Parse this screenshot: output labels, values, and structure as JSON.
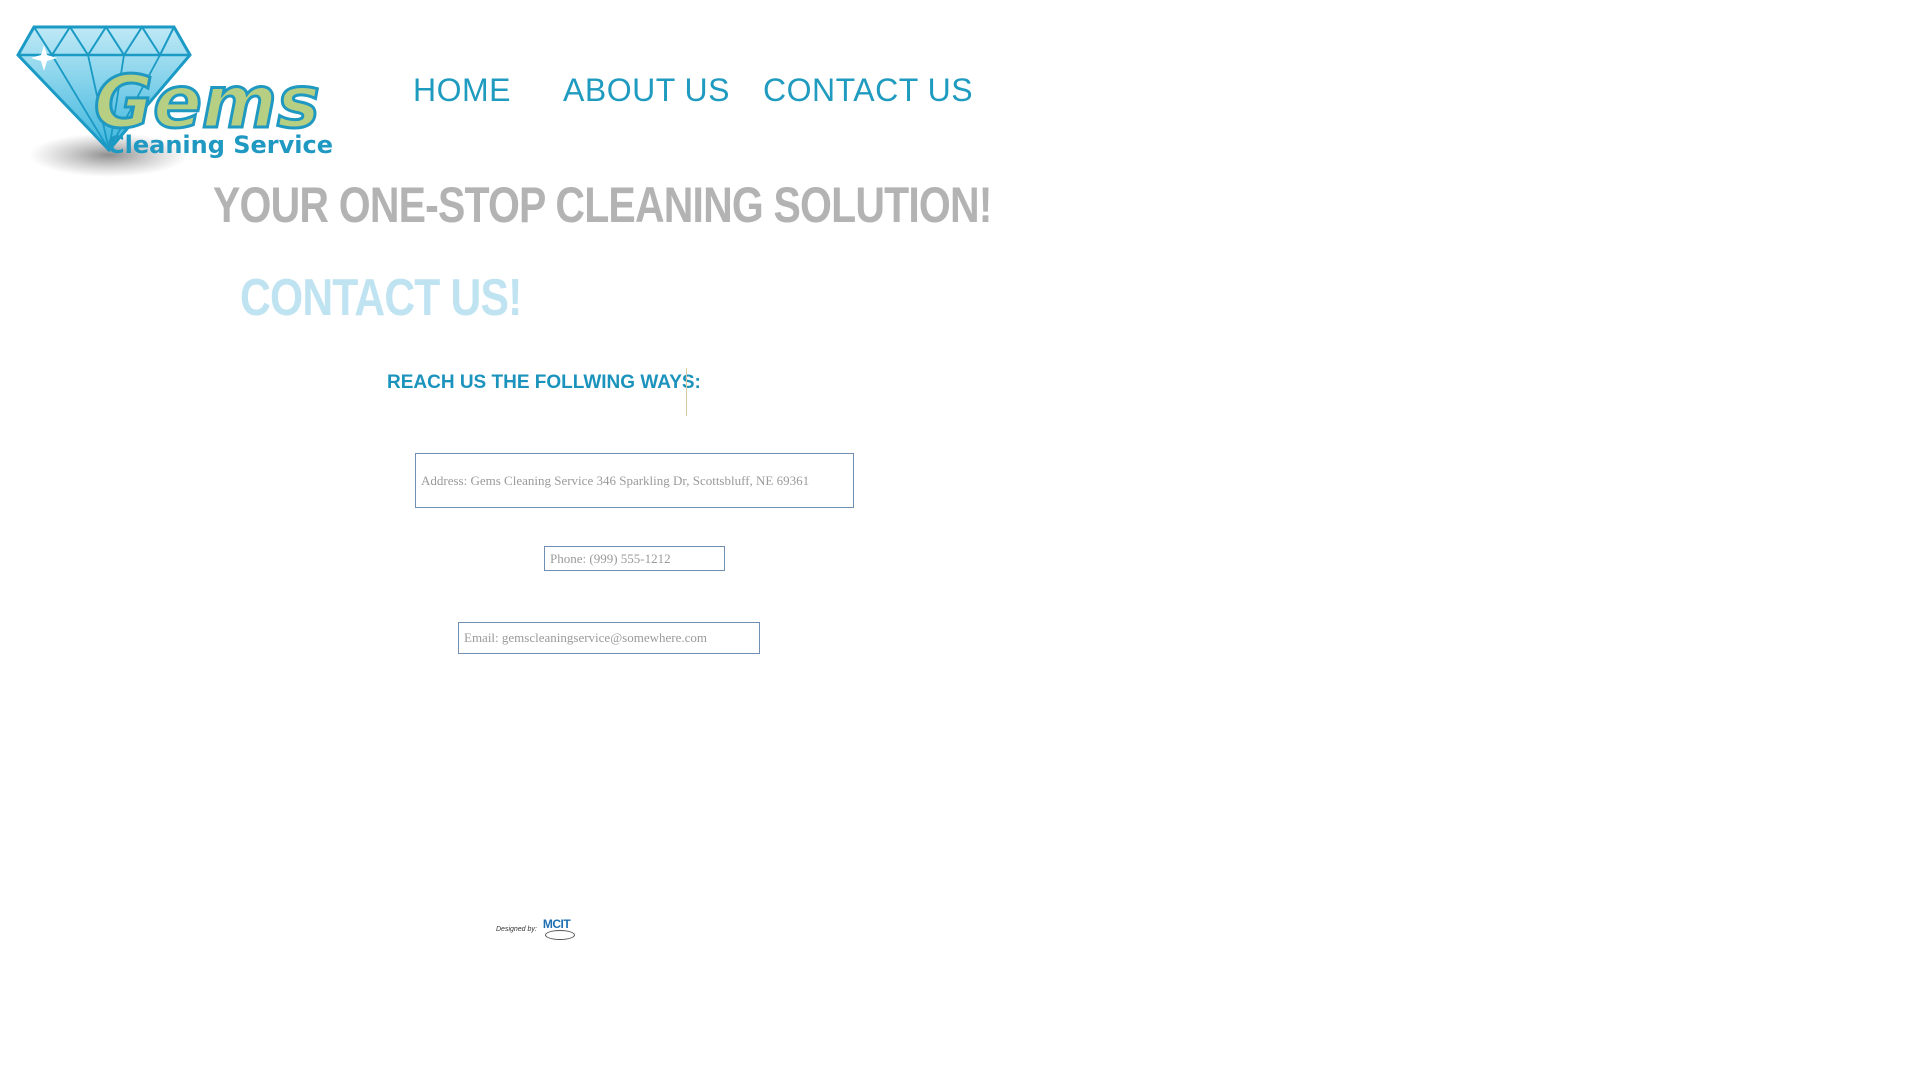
{
  "logo": {
    "brand_name": "Gems",
    "tagline": "Cleaning Service",
    "colors": {
      "diamond": "#3cb6dd",
      "diamond_light": "#bfe9f6",
      "brand_text": "#b7cf83",
      "brand_outline": "#1f98c2",
      "tagline": "#1f98c2"
    }
  },
  "nav": {
    "items": [
      {
        "label": "HOME"
      },
      {
        "label": "ABOUT US"
      },
      {
        "label": "CONTACT US"
      }
    ]
  },
  "main": {
    "headline": "YOUR ONE-STOP CLEANING SOLUTION!",
    "page_title": "CONTACT US!",
    "reach_heading": "REACH US THE FOLLWING WAYS:",
    "address": "Address: Gems Cleaning Service 346 Sparkling Dr, Scottsbluff, NE 69361",
    "phone": "Phone: (999) 555-1212",
    "email": "Email: gemscleaningservice@somewhere.com"
  },
  "footer": {
    "designed_by_label": "Designed by:",
    "designer_logo_text": "MCIT"
  },
  "colors": {
    "nav": "#1f9bbf",
    "headline": "#b3b3b3",
    "page_title": "#bfe3f1",
    "reach_heading": "#1b93bd",
    "box_border": "#6f8fb3",
    "box_text": "#9a9a9a"
  }
}
